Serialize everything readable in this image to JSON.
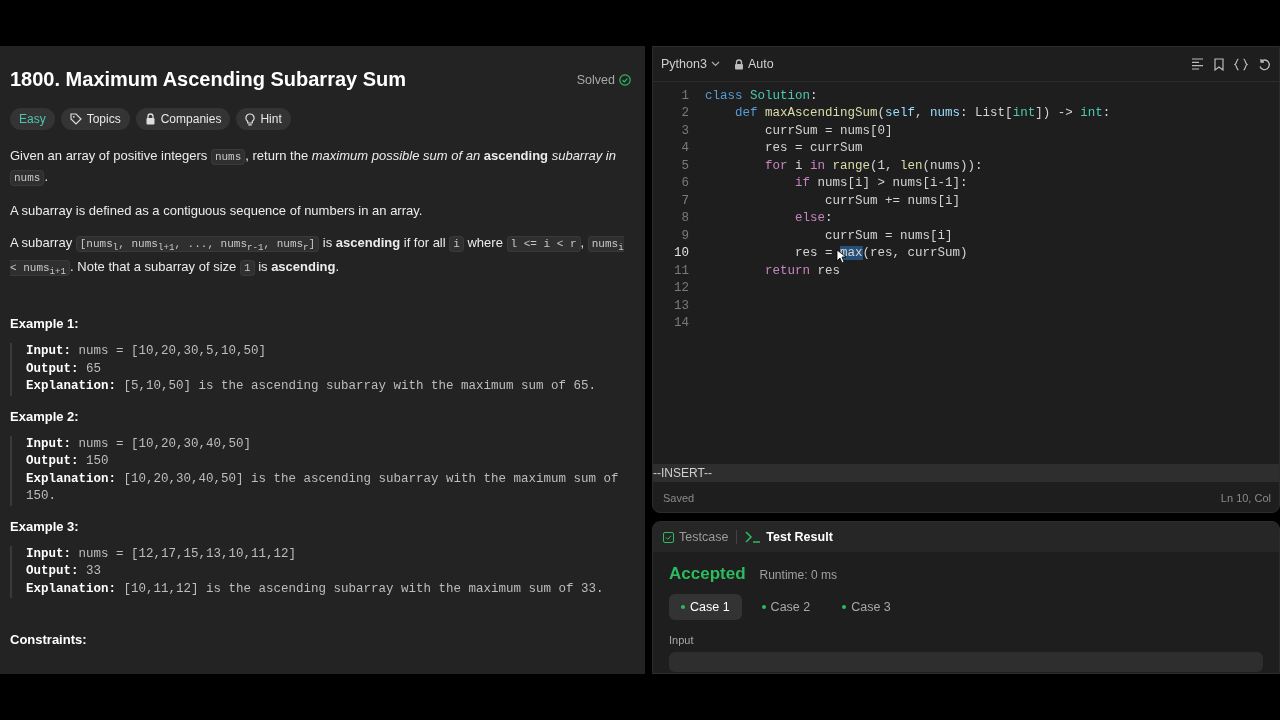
{
  "problem": {
    "title": "1800. Maximum Ascending Subarray Sum",
    "status": "Solved",
    "tags": [
      {
        "label": "Easy",
        "kind": "difficulty"
      },
      {
        "label": "Topics",
        "kind": "tag"
      },
      {
        "label": "Companies",
        "kind": "lock"
      },
      {
        "label": "Hint",
        "kind": "bulb"
      }
    ],
    "paragraphs": [
      [
        {
          "kind": "text",
          "text": "Given an array of positive integers "
        },
        {
          "kind": "code",
          "text": "nums"
        },
        {
          "kind": "text",
          "text": ", return the *maximum possible sum of an* **ascending** *subarray in* "
        },
        {
          "kind": "code",
          "text": "nums"
        },
        {
          "kind": "text",
          "text": "."
        }
      ],
      [
        {
          "kind": "text",
          "text": "A subarray is defined as a contiguous sequence of numbers in an array."
        }
      ],
      [
        {
          "kind": "text",
          "text": "A subarray "
        },
        {
          "kind": "code",
          "text": "[nums$_{l}$, nums$_{l+1}$, ..., nums$_{r-1}$, nums$_{r}$]"
        },
        {
          "kind": "text",
          "text": " is **ascending** if for all "
        },
        {
          "kind": "code",
          "text": "i"
        },
        {
          "kind": "text",
          "text": " where "
        },
        {
          "kind": "code",
          "text": "l <= i < r"
        },
        {
          "kind": "text",
          "text": ", "
        },
        {
          "kind": "code",
          "text": "nums$_{i}$  < nums$_{i+1}$"
        },
        {
          "kind": "text",
          "text": ". Note that a subarray of size "
        },
        {
          "kind": "code",
          "text": "1"
        },
        {
          "kind": "text",
          "text": " is **ascending**."
        }
      ]
    ],
    "examples": [
      {
        "heading": "Example 1:",
        "lines": [
          "**Input:** nums = [10,20,30,5,10,50]",
          "**Output:** 65",
          "**Explanation:** [5,10,50] is the ascending subarray with the maximum sum of 65."
        ]
      },
      {
        "heading": "Example 2:",
        "lines": [
          "**Input:** nums = [10,20,30,40,50]",
          "**Output:** 150",
          "**Explanation:** [10,20,30,40,50] is the ascending subarray with the maximum sum of 150."
        ]
      },
      {
        "heading": "Example 3:",
        "lines": [
          "**Input:** nums = [12,17,15,13,10,11,12]",
          "**Output:** 33",
          "**Explanation:** [10,11,12] is the ascending subarray with the maximum sum of 33."
        ]
      }
    ],
    "constraints_heading": "Constraints:"
  },
  "editor": {
    "language": "Python3",
    "mode": "Auto",
    "lines": [
      {
        "number": "1",
        "current": false,
        "tokens": [
          {
            "kind": "keyword",
            "text": "class"
          },
          {
            "kind": "class",
            "text": " Solution"
          },
          {
            "kind": "plain",
            "text": ":"
          }
        ]
      },
      {
        "number": "2",
        "current": false,
        "tokens": [
          {
            "kind": "keyword",
            "text": "    def"
          },
          {
            "kind": "function",
            "text": " maxAscendingSum"
          },
          {
            "kind": "plain",
            "text": "("
          },
          {
            "kind": "param",
            "text": "self"
          },
          {
            "kind": "plain",
            "text": ", "
          },
          {
            "kind": "param",
            "text": "nums"
          },
          {
            "kind": "plain",
            "text": ": List["
          },
          {
            "kind": "type",
            "text": "int"
          },
          {
            "kind": "plain",
            "text": "]) -> "
          },
          {
            "kind": "type",
            "text": "int"
          },
          {
            "kind": "plain",
            "text": ":"
          }
        ]
      },
      {
        "number": "3",
        "current": false,
        "tokens": [
          {
            "kind": "plain",
            "text": "        currSum = nums[0]"
          }
        ]
      },
      {
        "number": "4",
        "current": false,
        "tokens": [
          {
            "kind": "plain",
            "text": "        res = currSum"
          }
        ]
      },
      {
        "number": "5",
        "current": false,
        "tokens": [
          {
            "kind": "control",
            "text": "        for"
          },
          {
            "kind": "plain",
            "text": " i "
          },
          {
            "kind": "control",
            "text": "in"
          },
          {
            "kind": "function",
            "text": " range"
          },
          {
            "kind": "plain",
            "text": "(1, "
          },
          {
            "kind": "function",
            "text": "len"
          },
          {
            "kind": "plain",
            "text": "(nums)):"
          }
        ]
      },
      {
        "number": "6",
        "current": false,
        "tokens": [
          {
            "kind": "control",
            "text": "            if"
          },
          {
            "kind": "plain",
            "text": " nums[i] > nums[i-1]:"
          }
        ]
      },
      {
        "number": "7",
        "current": false,
        "tokens": [
          {
            "kind": "plain",
            "text": "                currSum += nums[i]"
          }
        ]
      },
      {
        "number": "8",
        "current": false,
        "tokens": [
          {
            "kind": "control",
            "text": "            else"
          },
          {
            "kind": "plain",
            "text": ":"
          }
        ]
      },
      {
        "number": "9",
        "current": false,
        "tokens": [
          {
            "kind": "plain",
            "text": "                currSum = nums[i]"
          }
        ]
      },
      {
        "number": "10",
        "current": true,
        "tokens": [
          {
            "kind": "plain",
            "text": "            res = "
          },
          {
            "kind": "selection",
            "text": "max"
          },
          {
            "kind": "plain",
            "text": "(res, currSum)"
          }
        ]
      },
      {
        "number": "11",
        "current": false,
        "tokens": [
          {
            "kind": "control",
            "text": "        return"
          },
          {
            "kind": "plain",
            "text": " res"
          }
        ]
      },
      {
        "number": "12",
        "current": false
      },
      {
        "number": "13",
        "current": false
      },
      {
        "number": "14",
        "current": false
      }
    ],
    "vim_mode": "--INSERT--",
    "save_status": "Saved",
    "position": "Ln 10, Col"
  },
  "results": {
    "tabs": [
      {
        "label": "Testcase",
        "kind": "checkbox",
        "selected": false
      },
      {
        "label": "Test Result",
        "kind": "terminal",
        "selected": true
      }
    ],
    "verdict": "Accepted",
    "runtime": "Runtime: 0 ms",
    "cases": [
      {
        "label": "Case 1",
        "selected": true
      },
      {
        "label": "Case 2",
        "selected": false
      },
      {
        "label": "Case 3",
        "selected": false
      }
    ],
    "input_label": "Input"
  }
}
